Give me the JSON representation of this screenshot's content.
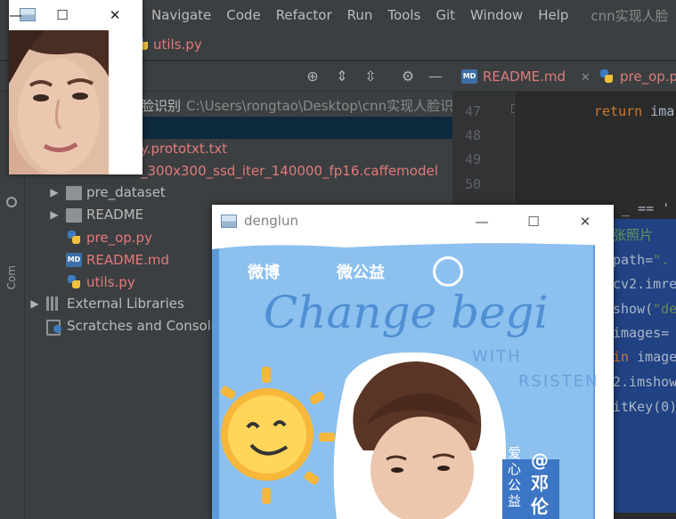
{
  "menu": {
    "items": [
      "Navigate",
      "Code",
      "Refactor",
      "Run",
      "Tools",
      "Git",
      "Window",
      "Help"
    ],
    "title": "cnn实现人脸"
  },
  "navbar": {
    "file": "utils.py"
  },
  "project": {
    "root_name": "脸识别",
    "root_path": "C:\\Users\\rongtao\\Desktop\\cnn实现人脸识别",
    "vertical_label": "Com",
    "tree": [
      {
        "label": "y.prototxt.txt",
        "kind": "file",
        "color": "red"
      },
      {
        "label": "_300x300_ssd_iter_140000_fp16.caffemodel",
        "kind": "file",
        "color": "red"
      },
      {
        "label": "pre_dataset",
        "kind": "folder",
        "color": "normal"
      },
      {
        "label": "README",
        "kind": "folder",
        "color": "normal"
      },
      {
        "label": "pre_op.py",
        "kind": "py",
        "color": "red"
      },
      {
        "label": "README.md",
        "kind": "md",
        "color": "red"
      },
      {
        "label": "utils.py",
        "kind": "py",
        "color": "red"
      },
      {
        "label": "External Libraries",
        "kind": "lib",
        "color": "normal"
      },
      {
        "label": "Scratches and Consoles",
        "kind": "scratch",
        "color": "normal"
      }
    ]
  },
  "editor": {
    "tabs": [
      {
        "label": "README.md",
        "icon": "md-file-icon"
      },
      {
        "label": "pre_op.p",
        "icon": "python-file-icon"
      }
    ],
    "line_numbers": [
      "47",
      "48",
      "49",
      "50"
    ],
    "code": {
      "l47_kw": "return",
      "l47_id": " ima",
      "l51": "_ == '",
      "l52": "张照片",
      "l53_id": "path=",
      "l53_str": "\".",
      "l54": "cv2.imre",
      "l55_id": "show(",
      "l55_str": "\"de",
      "l56": "images=",
      "l57_kw": "in",
      "l57_id": " image",
      "l58": "2.imshow",
      "l59": "itKey(0)"
    }
  },
  "small_window": {
    "min_label": "—",
    "max_label": "☐",
    "close_label": "✕"
  },
  "main_window": {
    "title": "denglun",
    "min_label": "—",
    "max_label": "☐",
    "close_label": "✕",
    "poster": {
      "logo1": "微博",
      "logo2": "微公益",
      "slogan": "Change begi",
      "sub1": "WITH",
      "sub2": "RSISTEN",
      "side_text": "爱心公益",
      "at_name": "@邓伦"
    }
  },
  "colors": {
    "vcs_modified": "#e07b7b",
    "selection": "#214283",
    "tree_selection": "#0d293e"
  }
}
